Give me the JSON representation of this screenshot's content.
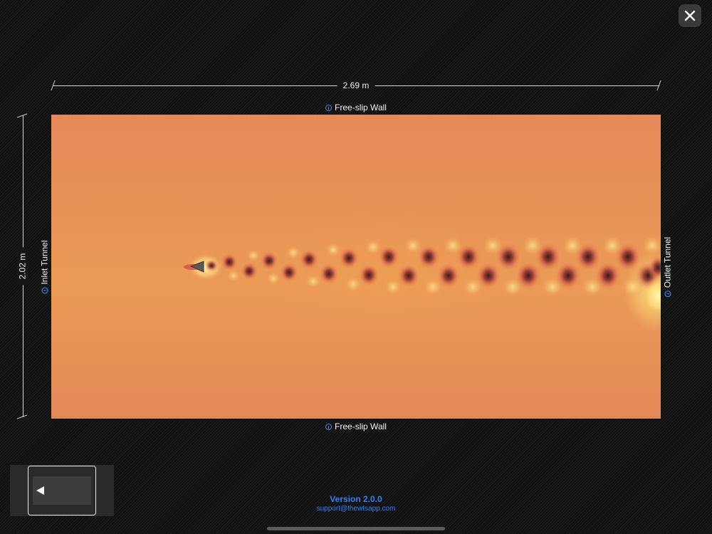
{
  "window": {
    "close_icon": "close-icon"
  },
  "dimensions": {
    "width_label": "2.69 m",
    "height_label": "2.02 m"
  },
  "boundaries": {
    "top": "Free-slip Wall",
    "bottom": "Free-slip Wall",
    "left": "Inlet Tunnel",
    "right": "Outlet Tunnel",
    "info_icon": "info-icon"
  },
  "colors": {
    "accent": "#2f80ff",
    "field_base": "#e8925a",
    "vortex_dark": "#3a1a1a",
    "vortex_light": "#ffe27a"
  },
  "footer": {
    "version": "Version 2.0.0",
    "support": "support@thewtsapp.com"
  },
  "thumbnail": {
    "arrow_icon": "play-left-icon"
  }
}
